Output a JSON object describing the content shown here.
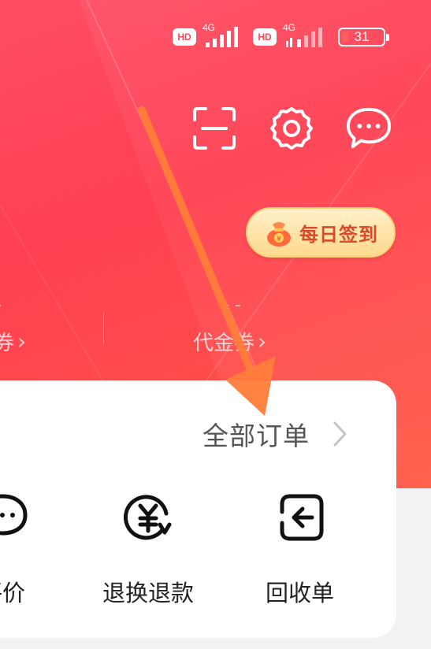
{
  "status_bar": {
    "hd1": "HD",
    "hd2": "HD",
    "net1": "4G",
    "net2": "4G",
    "battery": "31"
  },
  "header_icons": [
    "scan-icon",
    "settings-icon",
    "message-icon"
  ],
  "signin": {
    "label": "每日签到"
  },
  "coupons": [
    {
      "value": "-",
      "label": "券",
      "arrow": "›"
    },
    {
      "value": "- -",
      "label": "代金券",
      "arrow": "›"
    }
  ],
  "orders": {
    "all_orders_label": "全部订单",
    "items": [
      {
        "label": "评价",
        "icon": "comment-icon"
      },
      {
        "label": "退换退款",
        "icon": "refund-icon"
      },
      {
        "label": "回收单",
        "icon": "recycle-icon"
      }
    ]
  },
  "colors": {
    "header_red": "#ff4757",
    "signin_text": "#d94a2d",
    "annotation_arrow": "#ff7d3a"
  }
}
